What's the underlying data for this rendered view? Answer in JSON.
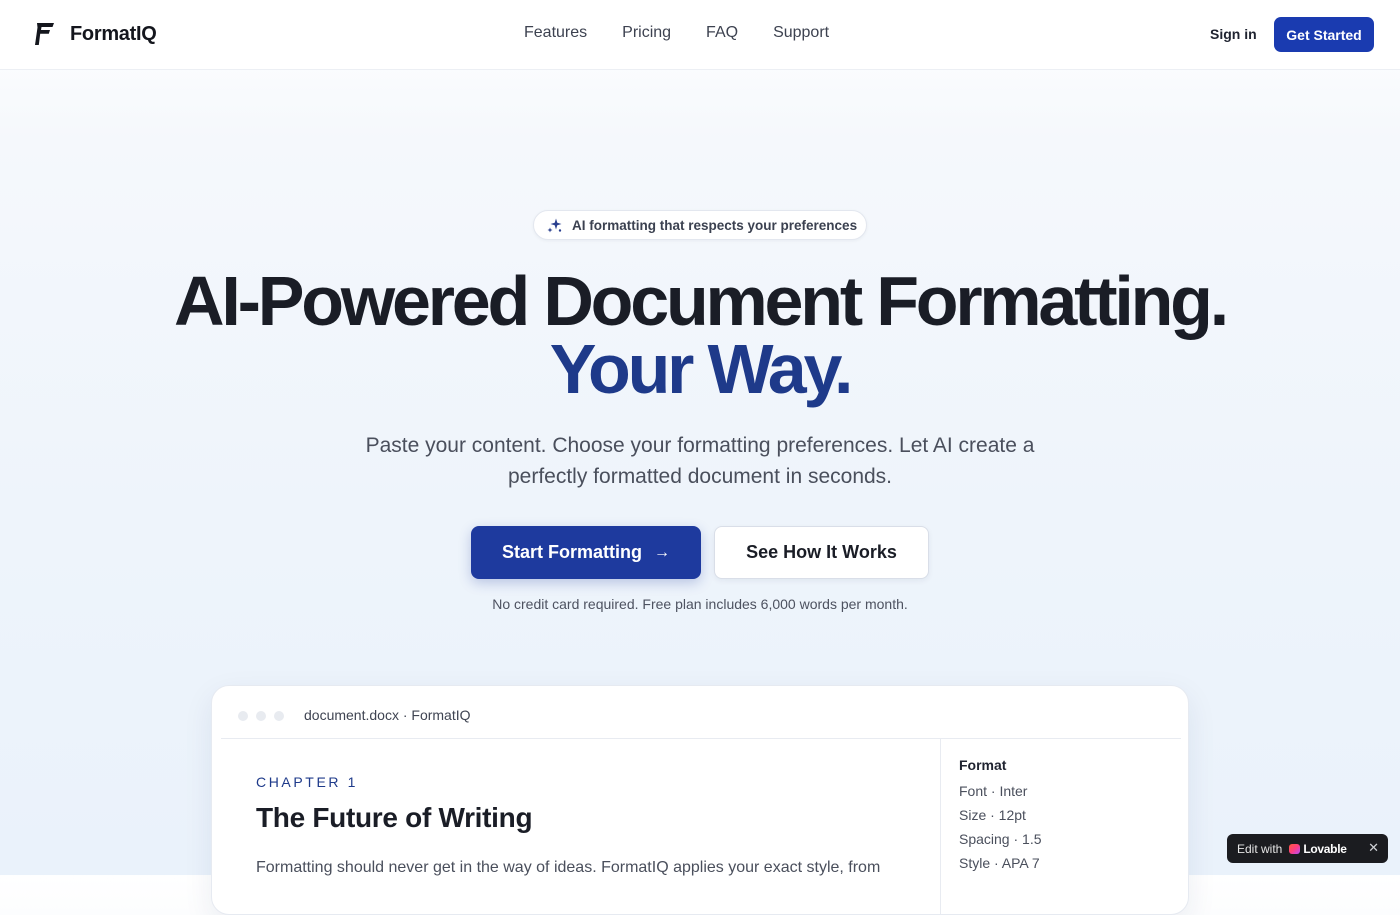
{
  "brand": {
    "name": "FormatIQ",
    "icon": "formatiq-logo-icon"
  },
  "nav": {
    "links": [
      "Features",
      "Pricing",
      "FAQ",
      "Support"
    ],
    "sign_in": "Sign in",
    "get_started": "Get Started"
  },
  "hero": {
    "pill_icon": "sparkles-icon",
    "pill_text": "AI formatting that respects your preferences",
    "headline_line1": "AI-Powered Document Formatting.",
    "headline_line2": "Your Way.",
    "subheadline": "Paste your content. Choose your formatting preferences. Let AI create a perfectly formatted document in seconds.",
    "primary_cta": "Start Formatting",
    "primary_cta_icon": "arrow-right-icon",
    "secondary_cta": "See How It Works",
    "note": "No credit card required. Free plan includes 6,000 words per month."
  },
  "preview": {
    "window_title": "document.docx · FormatIQ",
    "chapter_label": "CHAPTER 1",
    "doc_title": "The Future of Writing",
    "doc_body": "Formatting should never get in the way of ideas. FormatIQ applies your exact style, from",
    "format_panel": {
      "heading": "Format",
      "rows": [
        "Font · Inter",
        "Size · 12pt",
        "Spacing · 1.5",
        "Style · APA 7"
      ]
    }
  },
  "lovable_badge": {
    "edit_label": "Edit with",
    "brand": "Lovable",
    "close": "✕"
  },
  "colors": {
    "primary": "#1e3a9e",
    "headline_accent": "#1e3a8a",
    "text_dark": "#1a1d26",
    "text_muted": "#4a4f5c"
  }
}
